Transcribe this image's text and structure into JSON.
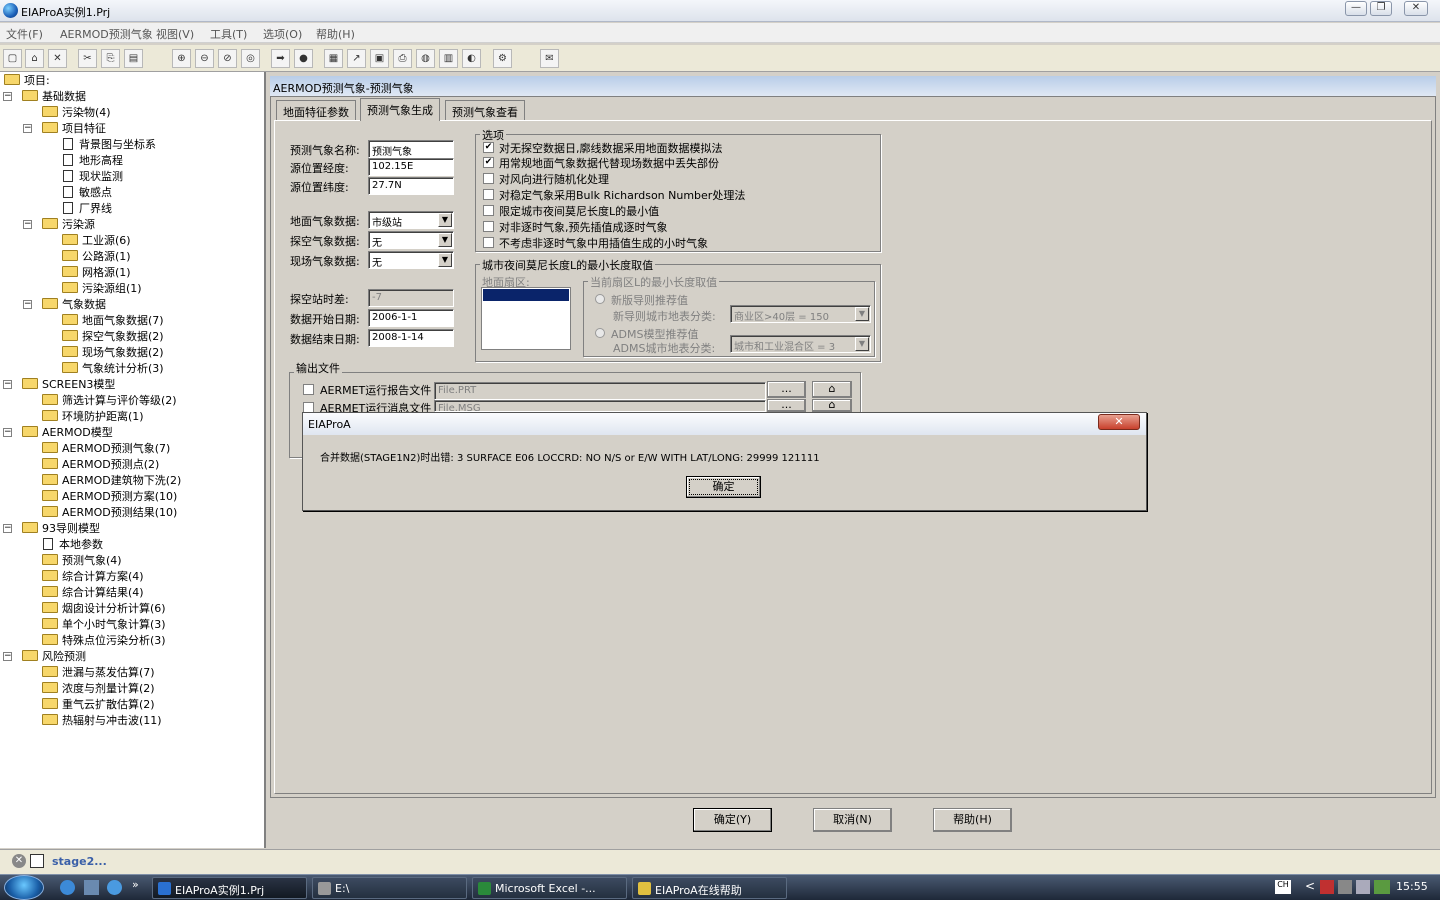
{
  "window": {
    "title": "EIAProA实例1.Prj",
    "min_label": "—",
    "restore_label": "❐",
    "close_label": "✕"
  },
  "menu": [
    "文件(F)",
    "AERMOD预测气象",
    "视图(V)",
    "工具(T)",
    "选项(O)",
    "帮助(H)"
  ],
  "tree": {
    "root": "项目:",
    "basic": "基础数据",
    "pollutants": "污染物(4)",
    "project_features": "项目特征",
    "bg_map": "背景图与坐标系",
    "terrain": "地形高程",
    "monitoring": "现状监测",
    "sensitive": "敏感点",
    "boundary": "厂界线",
    "sources": "污染源",
    "industrial": "工业源(6)",
    "road": "公路源(1)",
    "grid_src": "网格源(1)",
    "src_group": "污染源组(1)",
    "met_data": "气象数据",
    "surface_met": "地面气象数据(7)",
    "upper_met": "探空气象数据(2)",
    "site_met": "现场气象数据(2)",
    "met_stats": "气象统计分析(3)",
    "screen3": "SCREEN3模型",
    "screen_eval": "筛选计算与评价等级(2)",
    "protect_dist": "环境防护距离(1)",
    "aermod": "AERMOD模型",
    "aermod_met": "AERMOD预测气象(7)",
    "aermod_pts": "AERMOD预测点(2)",
    "aermod_bldg": "AERMOD建筑物下洗(2)",
    "aermod_plan": "AERMOD预测方案(10)",
    "aermod_res": "AERMOD预测结果(10)",
    "guide93": "93导则模型",
    "local_params": "本地参数",
    "pred_met": "预测气象(4)",
    "calc_plan": "综合计算方案(4)",
    "calc_res": "综合计算结果(4)",
    "stack": "烟囱设计分析计算(6)",
    "hourly": "单个小时气象计算(3)",
    "special": "特殊点位污染分析(3)",
    "risk": "风险预测",
    "leak": "泄漏与蒸发估算(7)",
    "dose": "浓度与剂量计算(2)",
    "heavy_gas": "重气云扩散估算(2)",
    "thermal": "热辐射与冲击波(11)"
  },
  "main": {
    "header": "AERMOD预测气象-预测气象",
    "tabs": [
      "地面特征参数",
      "预测气象生成",
      "预测气象查看"
    ],
    "form": {
      "name_label": "预测气象名称:",
      "name_value": "预测气象",
      "lon_label": "源位置经度:",
      "lon_value": "102.15E",
      "lat_label": "源位置纬度:",
      "lat_value": "27.7N",
      "surface_label": "地面气象数据:",
      "surface_value": "市级站",
      "upper_label": "探空气象数据:",
      "upper_value": "无",
      "site_label": "现场气象数据:",
      "site_value": "无",
      "tz_label": "探空站时差:",
      "tz_value": "-7",
      "start_label": "数据开始日期:",
      "start_value": "2006-1-1",
      "end_label": "数据结束日期:",
      "end_value": "2008-1-14"
    },
    "options": {
      "title": "选项",
      "items": [
        {
          "label": "对无探空数据日,廓线数据采用地面数据模拟法",
          "checked": true
        },
        {
          "label": "用常规地面气象数据代替现场数据中丢失部份",
          "checked": true
        },
        {
          "label": "对风向进行随机化处理",
          "checked": false
        },
        {
          "label": "对稳定气象采用Bulk Richardson Number处理法",
          "checked": false
        },
        {
          "label": "限定城市夜间莫尼长度L的最小值",
          "checked": false
        },
        {
          "label": "对非逐时气象,预先插值成逐时气象",
          "checked": false
        },
        {
          "label": "不考虑非逐时气象中用插值生成的小时气象",
          "checked": false
        }
      ]
    },
    "monin": {
      "title": "城市夜间莫尼长度L的最小长度取值",
      "sector_label": "地面扇区:",
      "current_title": "当前扇区L的最小长度取值",
      "new_guide": "新版导则推荐值",
      "new_class_label": "新导则城市地表分类:",
      "new_class_value": "商业区>40层    = 150",
      "adms": "ADMS模型推荐值",
      "adms_class_label": "ADMS城市地表分类:",
      "adms_class_value": "城市和工业混合区  = 3"
    },
    "output": {
      "title": "输出文件",
      "report_label": "AERMET运行报告文件",
      "report_value": "File.PRT",
      "msg_label": "AERMET运行消息文件",
      "msg_value": "File.MSG",
      "browse": "..."
    },
    "buttons": {
      "ok": "确定(Y)",
      "cancel": "取消(N)",
      "help": "帮助(H)"
    }
  },
  "dialog": {
    "title": "EIAProA",
    "message": "合并数据(STAGE1N2)时出错:        3 SURFACE    E06 LOCCRD: NO N/S or E/W WITH LAT/LONG:    29999   121111",
    "ok": "确定",
    "close": "✕"
  },
  "status": {
    "item": "stage2..."
  },
  "taskbar": {
    "tasks": [
      "EIAProA实例1.Prj",
      "E:\\",
      "Microsoft Excel -...",
      "EIAProA在线帮助"
    ],
    "clock": "15:55"
  }
}
